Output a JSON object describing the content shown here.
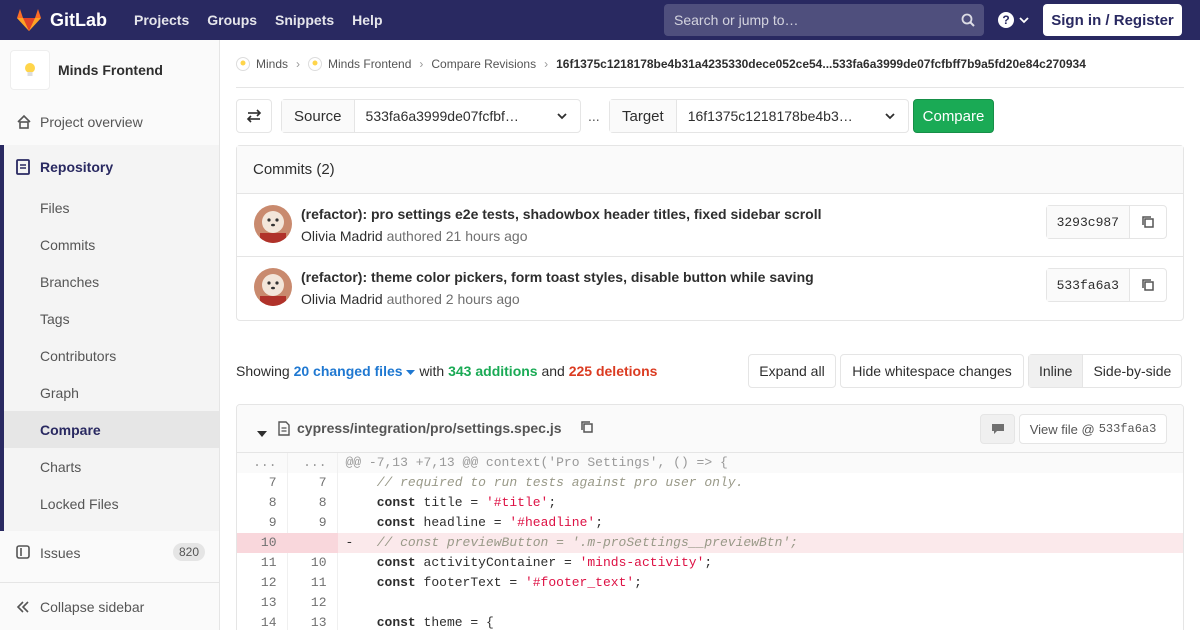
{
  "navbar": {
    "brand": "GitLab",
    "links": [
      "Projects",
      "Groups",
      "Snippets",
      "Help"
    ],
    "search_placeholder": "Search or jump to…",
    "help_glyph": "?",
    "signin": "Sign in / Register",
    "bg_color": "#292961"
  },
  "sidebar": {
    "project_name": "Minds Frontend",
    "project_overview": "Project overview",
    "repository": "Repository",
    "repo_items": [
      "Files",
      "Commits",
      "Branches",
      "Tags",
      "Contributors",
      "Graph",
      "Compare",
      "Charts",
      "Locked Files"
    ],
    "active_item": "Compare",
    "issues": "Issues",
    "issues_count": "820",
    "collapse": "Collapse sidebar"
  },
  "breadcrumbs": {
    "items": [
      "Minds",
      "Minds Frontend",
      "Compare Revisions"
    ],
    "current": "16f1375c1218178be4b31a4235330dece052ce54...533fa6a3999de07fcfbff7b9a5fd20e84c270934"
  },
  "compare": {
    "source_label": "Source",
    "source_value": "533fa6a3999de07fcfbf…",
    "dots": "...",
    "target_label": "Target",
    "target_value": "16f1375c1218178be4b3…",
    "button": "Compare"
  },
  "commits": {
    "header": "Commits (2)",
    "list": [
      {
        "title": "(refactor): pro settings e2e tests, shadowbox header titles, fixed sidebar scroll",
        "author": "Olivia Madrid",
        "verb": "authored",
        "time": "21 hours ago",
        "sha": "3293c987"
      },
      {
        "title": "(refactor): theme color pickers, form toast styles, disable button while saving",
        "author": "Olivia Madrid",
        "verb": "authored",
        "time": "2 hours ago",
        "sha": "533fa6a3"
      }
    ]
  },
  "files": {
    "showing": "Showing",
    "changed": "20 changed files",
    "with": "with",
    "additions": "343 additions",
    "and": "and",
    "deletions": "225 deletions",
    "expand_all": "Expand all",
    "hide_whitespace": "Hide whitespace changes",
    "inline": "Inline",
    "side_by_side": "Side-by-side"
  },
  "diff": {
    "path": "cypress/integration/pro/settings.spec.js",
    "view_file": "View file @",
    "view_sha": "533fa6a3"
  },
  "colors": {
    "accent": "#292961",
    "compare_green": "#1aaa55",
    "link_blue": "#1f78d1",
    "deletion_red": "#db3b21"
  }
}
